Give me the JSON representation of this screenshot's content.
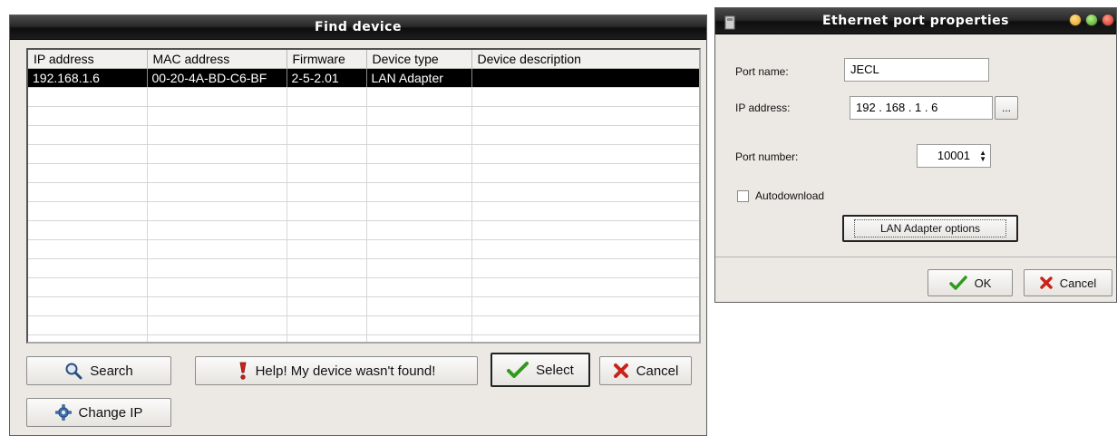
{
  "find_device": {
    "title": "Find device",
    "columns": [
      "IP address",
      "MAC address",
      "Firmware",
      "Device type",
      "Device description"
    ],
    "rows": [
      {
        "ip": "192.168.1.6",
        "mac": "00-20-4A-BD-C6-BF",
        "firmware": "2-5-2.01",
        "type": "LAN Adapter",
        "description": ""
      }
    ],
    "buttons": {
      "search": "Search",
      "help": "Help! My device wasn't found!",
      "select": "Select",
      "cancel": "Cancel",
      "change_ip": "Change IP"
    }
  },
  "ethernet_props": {
    "title": "Ethernet port properties",
    "port_name_label": "Port name:",
    "port_name_value": "JECL",
    "ip_label": "IP address:",
    "ip_value": "192 . 168 .  1  .  6",
    "browse_label": "...",
    "port_number_label": "Port number:",
    "port_number_value": "10001",
    "autodownload_label": "Autodownload",
    "autodownload_checked": false,
    "lan_options_label": "LAN Adapter options",
    "ok_label": "OK",
    "cancel_label": "Cancel"
  },
  "icons": {
    "search": "magnifier-icon",
    "help": "exclamation-icon",
    "select": "green-check-icon",
    "cancel": "red-x-icon",
    "change_ip": "gear-icon"
  },
  "colors": {
    "title_bar": "#1c1c1c",
    "selected_row": "#000000",
    "check_green": "#2f9a1c",
    "cancel_red": "#c8221b",
    "window_bg": "#ece9e4"
  }
}
